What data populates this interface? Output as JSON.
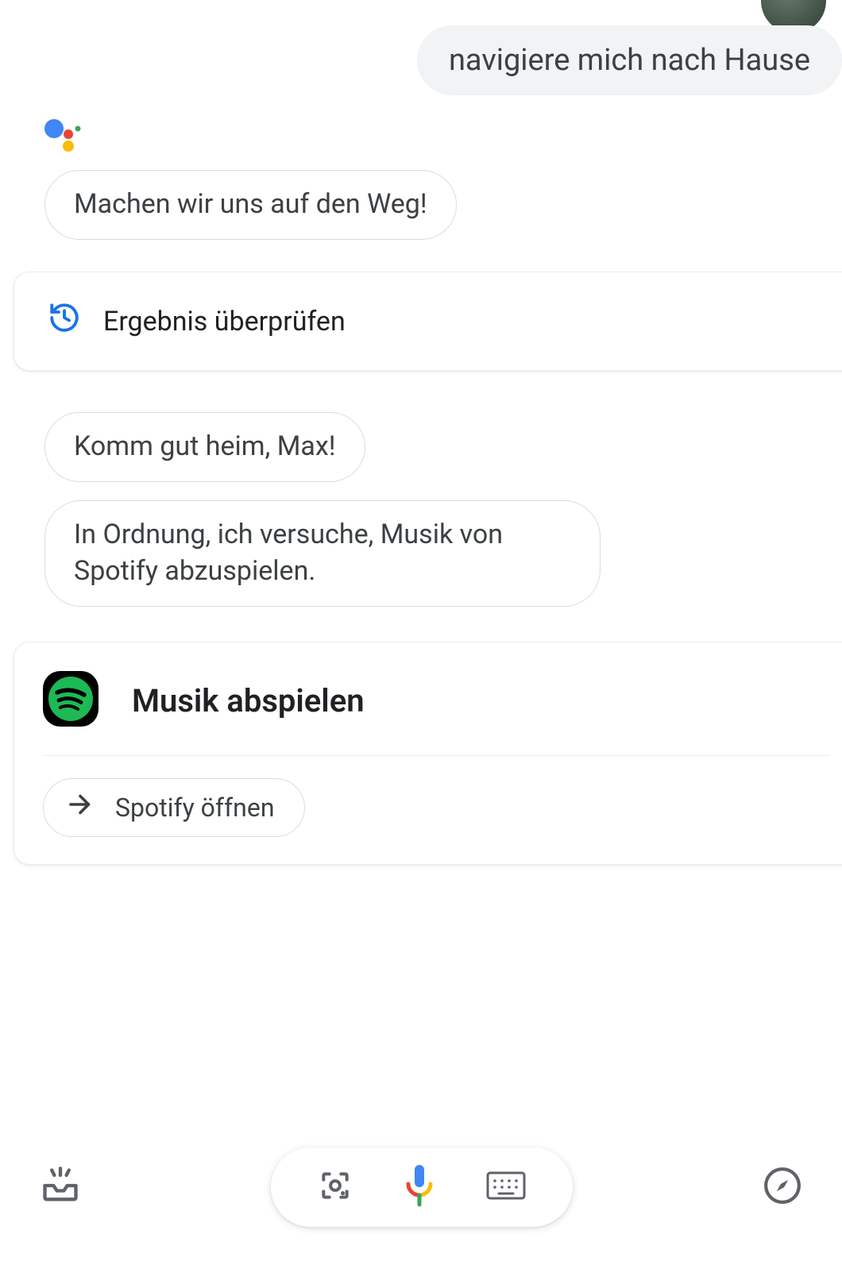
{
  "user_message": "navigiere mich nach Hause",
  "assistant": {
    "reply1": "Machen wir uns auf den Weg!",
    "reply2": "Komm gut heim, Max!",
    "reply3": "In Ordnung, ich versuche, Musik von Spotify abzuspielen."
  },
  "result_card": {
    "label": "Ergebnis überprüfen"
  },
  "music_card": {
    "title": "Musik abspielen",
    "open_label": "Spotify öffnen"
  },
  "icons": {
    "history": "history-icon",
    "spotify": "spotify-icon",
    "arrow": "arrow-right-icon",
    "inbox": "inbox-sparkle-icon",
    "lens": "google-lens-icon",
    "mic": "microphone-icon",
    "keyboard": "keyboard-icon",
    "compass": "compass-icon",
    "assistant_logo": "google-assistant-logo"
  },
  "colors": {
    "blue": "#4285f4",
    "red": "#ea4335",
    "yellow": "#fbbc04",
    "green": "#34a853",
    "spotify_green": "#1db954",
    "gray": "#5f6368"
  }
}
